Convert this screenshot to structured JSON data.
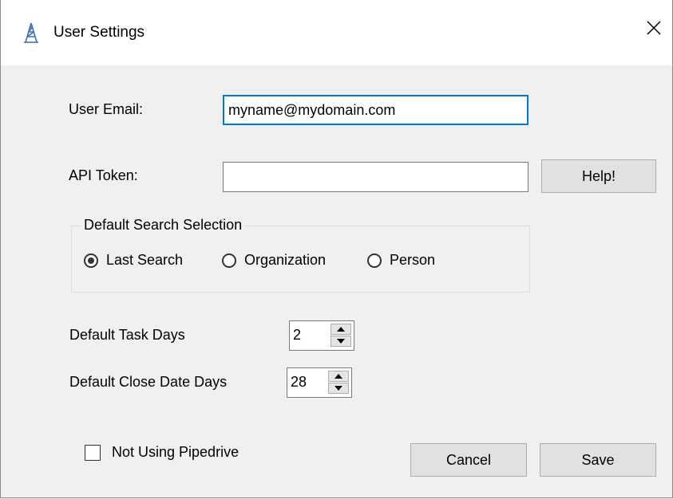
{
  "window": {
    "title": "User Settings",
    "icon": "tower-icon"
  },
  "fields": {
    "email_label": "User Email:",
    "email_value": "myname@mydomain.com",
    "token_label": "API Token:",
    "token_value": "",
    "help_label": "Help!"
  },
  "search_group": {
    "title": "Default Search Selection",
    "options": [
      {
        "label": "Last Search",
        "selected": true
      },
      {
        "label": "Organization",
        "selected": false
      },
      {
        "label": "Person",
        "selected": false
      }
    ]
  },
  "task_days": {
    "label": "Default Task Days",
    "value": "2"
  },
  "close_days": {
    "label": "Default Close Date Days",
    "value": "28"
  },
  "pipedrive": {
    "label": "Not Using Pipedrive",
    "checked": false
  },
  "buttons": {
    "cancel": "Cancel",
    "save": "Save"
  },
  "colors": {
    "focus": "#0078d7",
    "icon": "#3b6fb6"
  }
}
